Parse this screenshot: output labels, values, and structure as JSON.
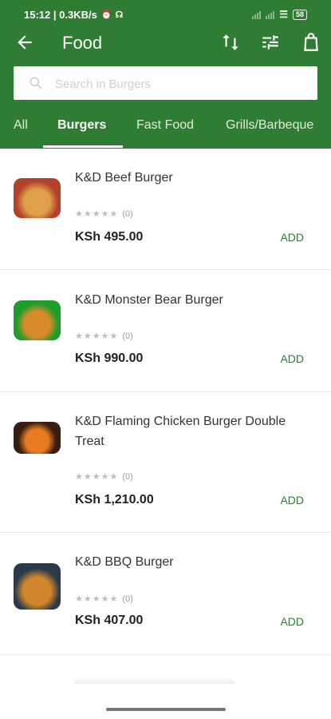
{
  "status_bar": {
    "time_speed": "15:12 | 0.3KB/s",
    "battery": "58"
  },
  "toolbar": {
    "title": "Food"
  },
  "search": {
    "placeholder": "Search in Burgers"
  },
  "tabs": [
    {
      "label": "All",
      "active": false
    },
    {
      "label": "Burgers",
      "active": true
    },
    {
      "label": "Fast Food",
      "active": false
    },
    {
      "label": "Grills/Barbeque",
      "active": false
    }
  ],
  "products": [
    {
      "name": "K&D Beef Burger",
      "rating_count": "(0)",
      "price": "KSh 495.00",
      "add_label": "ADD",
      "colors": [
        "#b3412c",
        "#e0a048"
      ]
    },
    {
      "name": "K&D Monster Bear Burger",
      "rating_count": "(0)",
      "price": "KSh 990.00",
      "add_label": "ADD",
      "colors": [
        "#1f9d2a",
        "#d98a2b"
      ]
    },
    {
      "name": "K&D Flaming Chicken Burger Double Treat",
      "rating_count": "(0)",
      "price": "KSh 1,210.00",
      "add_label": "ADD",
      "colors": [
        "#3a1d12",
        "#e87b22"
      ]
    },
    {
      "name": "K&D BBQ Burger",
      "rating_count": "(0)",
      "price": "KSh 407.00",
      "add_label": "ADD",
      "colors": [
        "#2b3a4a",
        "#d2862b"
      ]
    }
  ],
  "colors": {
    "primary": "#2e7d32",
    "accent_text": "#2e7d32"
  }
}
